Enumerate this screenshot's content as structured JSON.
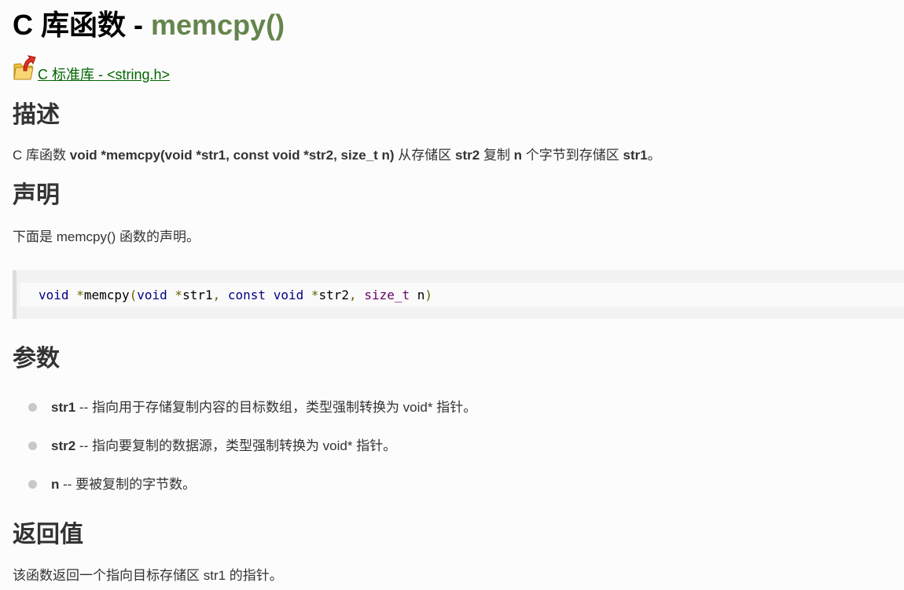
{
  "title": {
    "prefix": "C 库函数 - ",
    "function": "memcpy()"
  },
  "back_link": {
    "icon": "folder-up-arrow-icon",
    "label": " C 标准库 - <string.h>"
  },
  "sections": {
    "description": {
      "heading": "描述",
      "text_prefix": "C 库函数 ",
      "signature": "void *memcpy(void *str1, const void *str2, size_t n)",
      "text_mid1": " 从存储区 ",
      "src": "str2",
      "text_mid2": " 复制 ",
      "n": "n",
      "text_mid3": " 个字节到存储区 ",
      "dest": "str1",
      "text_end": "。"
    },
    "declaration": {
      "heading": "声明",
      "intro": "下面是 memcpy() 函数的声明。",
      "code": {
        "t1": "void",
        "t2": " ",
        "t3": "*",
        "t4": "memcpy",
        "t5": "(",
        "t6": "void",
        "t7": " ",
        "t8": "*",
        "t9": "str1",
        "t10": ",",
        "t11": " ",
        "t12": "const",
        "t13": " ",
        "t14": "void",
        "t15": " ",
        "t16": "*",
        "t17": "str2",
        "t18": ",",
        "t19": " ",
        "t20": "size_t",
        "t21": " n",
        "t22": ")"
      }
    },
    "parameters": {
      "heading": "参数",
      "items": [
        {
          "name": "str1",
          "desc": " -- 指向用于存储复制内容的目标数组，类型强制转换为 void* 指针。"
        },
        {
          "name": "str2",
          "desc": " -- 指向要复制的数据源，类型强制转换为 void* 指针。"
        },
        {
          "name": "n",
          "desc": " -- 要被复制的字节数。"
        }
      ]
    },
    "return_value": {
      "heading": "返回值",
      "text": "该函数返回一个指向目标存储区 str1 的指针。"
    }
  },
  "colors": {
    "function_name": "#64854c",
    "link": "#006600",
    "keyword": "#000088",
    "type": "#660066"
  }
}
